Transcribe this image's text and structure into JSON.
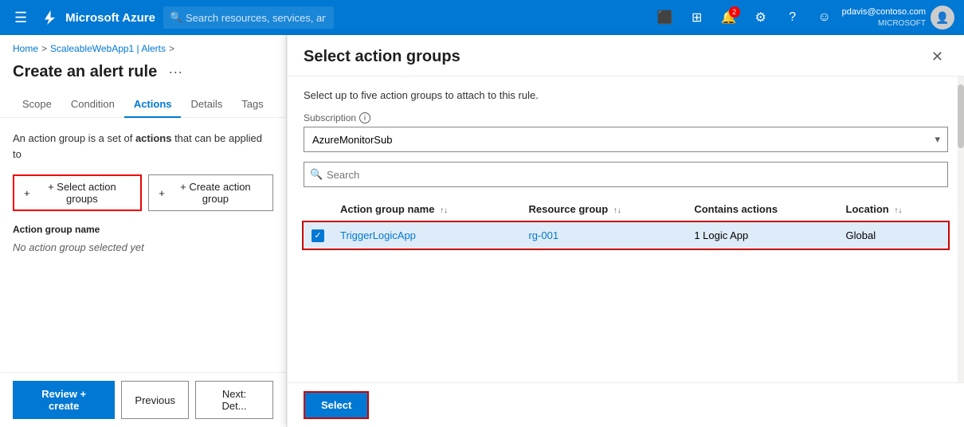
{
  "nav": {
    "hamburger_icon": "☰",
    "logo_text": "Microsoft Azure",
    "search_placeholder": "Search resources, services, and docs (G+/)",
    "notification_badge": "2",
    "user_email": "pdavis@contoso.com",
    "user_tenant": "MICROSOFT"
  },
  "left_panel": {
    "breadcrumb": {
      "home": "Home",
      "separator1": ">",
      "app": "ScaleableWebApp1 | Alerts",
      "separator2": ">"
    },
    "page_title": "Create an alert rule",
    "tabs": [
      {
        "id": "scope",
        "label": "Scope"
      },
      {
        "id": "condition",
        "label": "Condition"
      },
      {
        "id": "actions",
        "label": "Actions",
        "active": true
      },
      {
        "id": "details",
        "label": "Details"
      },
      {
        "id": "tags",
        "label": "Tags"
      }
    ],
    "action_description": "An action group is a set of actions that can be applied to",
    "buttons": {
      "select_action_groups": "+ Select action groups",
      "create_action_group": "+ Create action group"
    },
    "section_label": "Action group name",
    "no_selection": "No action group selected yet",
    "footer": {
      "review_create": "Review + create",
      "previous": "Previous",
      "next": "Next: Det..."
    }
  },
  "right_panel": {
    "title": "Select action groups",
    "description": "Select up to five action groups to attach to this rule.",
    "subscription_label": "Subscription",
    "subscription_info_icon": "ⓘ",
    "subscription_value": "AzureMonitorSub",
    "search_placeholder": "Search",
    "table": {
      "columns": [
        {
          "id": "checkbox",
          "label": ""
        },
        {
          "id": "name",
          "label": "Action group name",
          "sortable": true
        },
        {
          "id": "resource_group",
          "label": "Resource group",
          "sortable": true
        },
        {
          "id": "contains_actions",
          "label": "Contains actions",
          "sortable": false
        },
        {
          "id": "location",
          "label": "Location",
          "sortable": true
        }
      ],
      "rows": [
        {
          "selected": true,
          "name": "TriggerLogicApp",
          "resource_group": "rg-001",
          "contains_actions": "1 Logic App",
          "location": "Global"
        }
      ]
    },
    "footer": {
      "select_label": "Select"
    }
  }
}
